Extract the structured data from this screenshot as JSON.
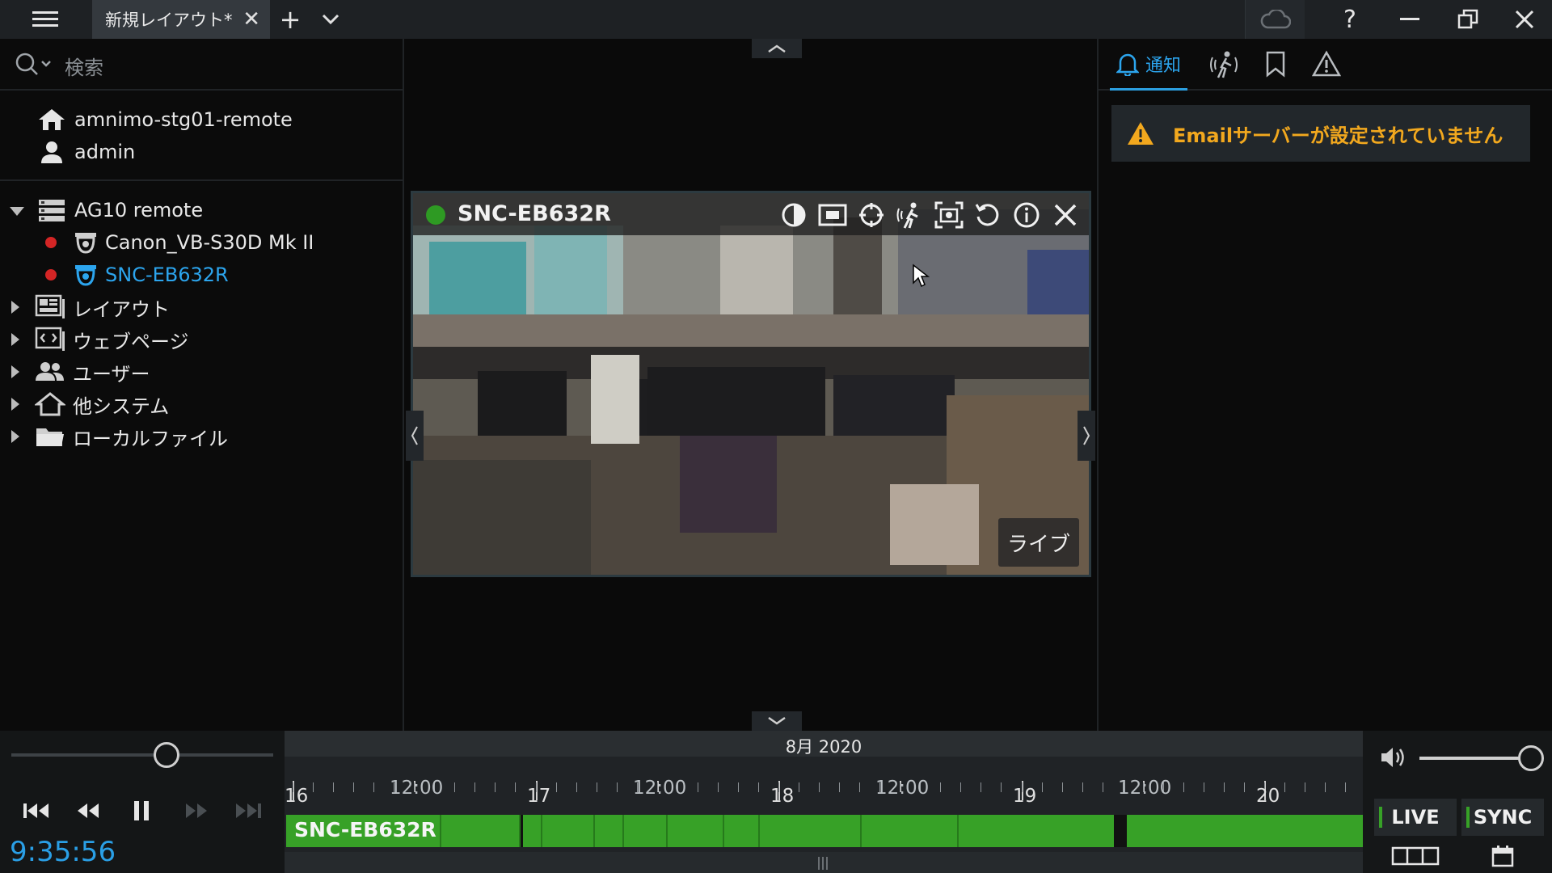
{
  "titlebar": {
    "tab_label": "新規レイアウト*",
    "tab_close": "✕",
    "add_tab": "+",
    "tab_menu": "⌄",
    "help": "?",
    "minimize": "—",
    "restore": "❐",
    "close": "✕"
  },
  "search": {
    "placeholder": "検索"
  },
  "server": {
    "name": "amnimo-stg01-remote",
    "user": "admin"
  },
  "tree": {
    "server_group": "AG10 remote",
    "cameras": [
      "Canon_VB-S30D Mk II",
      "SNC-EB632R"
    ],
    "folders": [
      "レイアウト",
      "ウェブページ",
      "ユーザー",
      "他システム",
      "ローカルファイル"
    ]
  },
  "camera": {
    "title": "SNC-EB632R",
    "status_badge": "ライブ"
  },
  "notifications": {
    "active_tab": "通知",
    "alert": "Emailサーバーが設定されていません"
  },
  "playback": {
    "time": "9:35:56",
    "position": 0.52
  },
  "timeline": {
    "month": "8月 2020",
    "labels": [
      "16",
      "12:00",
      "17",
      "12:00",
      "18",
      "12:00",
      "19",
      "12:00",
      "20"
    ],
    "track_label": "SNC-EB632R"
  },
  "controls": {
    "live": "LIVE",
    "sync": "SYNC",
    "volume": 1.0
  },
  "colors": {
    "accent": "#2c9fe0",
    "recording": "#37a127",
    "warning": "#f2a81e",
    "offline": "#d42525"
  }
}
